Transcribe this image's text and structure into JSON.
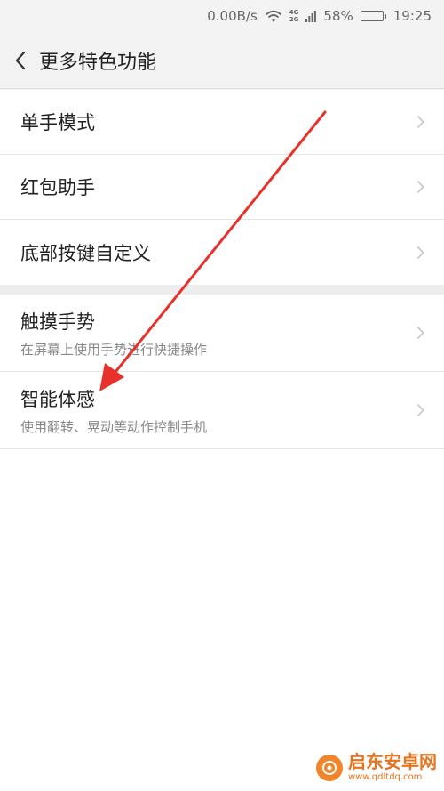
{
  "status_bar": {
    "speed": "0.00B/s",
    "net_top": "4G",
    "net_bottom": "2G",
    "battery": "58%",
    "battery_level": 0.58,
    "time": "19:25"
  },
  "header": {
    "title": "更多特色功能"
  },
  "section_1": [
    {
      "title": "单手模式"
    },
    {
      "title": "红包助手"
    },
    {
      "title": "底部按键自定义"
    }
  ],
  "section_2": [
    {
      "title": "触摸手势",
      "subtitle": "在屏幕上使用手势进行快捷操作"
    },
    {
      "title": "智能体感",
      "subtitle": "使用翻转、晃动等动作控制手机"
    }
  ],
  "watermark": {
    "name": "启东安卓网",
    "url": "www.qdltdq.com"
  },
  "colors": {
    "arrow": "#e8312a",
    "brand": "#e8731e"
  }
}
